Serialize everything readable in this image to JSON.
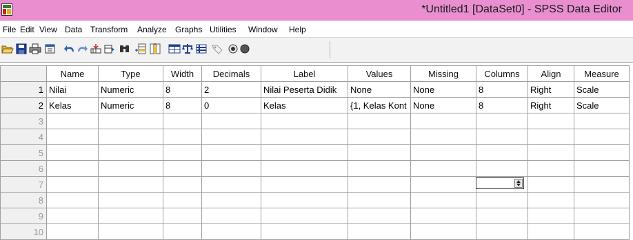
{
  "window": {
    "title": "*Untitled1 [DataSet0] - SPSS Data Editor"
  },
  "menu": [
    "File",
    "Edit",
    "View",
    "Data",
    "Transform",
    "Analyze",
    "Graphs",
    "Utilities",
    "Window",
    "Help"
  ],
  "toolbar": {
    "icons": [
      "open-icon",
      "save-icon",
      "print-icon",
      "dialog-recall-icon",
      "undo-icon",
      "redo-icon",
      "goto-case-icon",
      "variables-icon",
      "find-icon",
      "insert-cases-icon",
      "insert-variable-icon",
      "split-file-icon",
      "weight-cases-icon",
      "select-cases-icon",
      "value-labels-icon",
      "use-sets-icon",
      "show-all-icon"
    ]
  },
  "grid": {
    "columns": [
      "Name",
      "Type",
      "Width",
      "Decimals",
      "Label",
      "Values",
      "Missing",
      "Columns",
      "Align",
      "Measure"
    ],
    "rows": [
      [
        "Nilai",
        "Numeric",
        "8",
        "2",
        "Nilai Peserta Didik",
        "None",
        "None",
        "8",
        "Right",
        "Scale"
      ],
      [
        "Kelas",
        "Numeric",
        "8",
        "0",
        "Kelas",
        "{1, Kelas Kont",
        "None",
        "8",
        "Right",
        "Scale"
      ]
    ],
    "row_numbers": [
      "1",
      "2",
      "3",
      "4",
      "5",
      "6",
      "7",
      "8",
      "9",
      "10"
    ]
  },
  "colors": {
    "titlebar": "#e98fd0",
    "toolbar": "#f2f2f2",
    "rowheader": "#f0f0f0",
    "gridline": "#a0a0a0"
  }
}
